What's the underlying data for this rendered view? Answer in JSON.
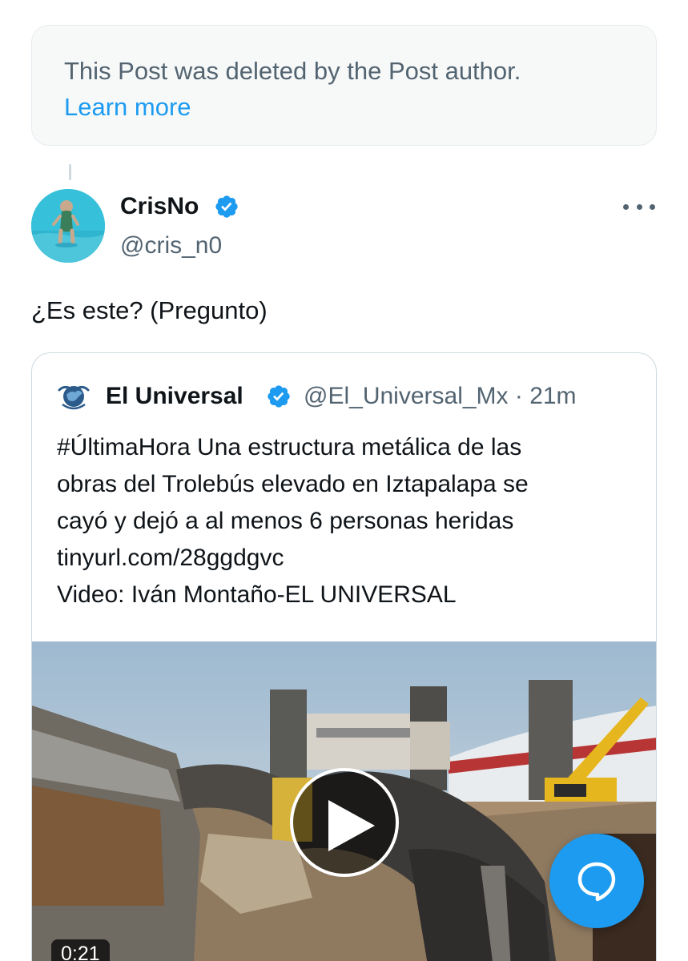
{
  "deleted_notice": {
    "text": "This Post was deleted by the Post author.",
    "link_label": "Learn more"
  },
  "post": {
    "author_name": "CrisNo",
    "author_handle": "@cris_n0",
    "verified": true,
    "more_icon": "more-horizontal-icon",
    "text": "¿Es este? (Pregunto)"
  },
  "quoted_post": {
    "author_name": "El Universal",
    "verified": true,
    "meta": "@El_Universal_Mx · 21m",
    "body_lines": [
      "#ÚltimaHora Una estructura metálica de las",
      "obras del Trolebús elevado en Iztapalapa se",
      "cayó y dejó a al menos 6 personas heridas",
      "tinyurl.com/28ggdgvc",
      "Video: Iván Montaño-EL UNIVERSAL"
    ],
    "video": {
      "duration": "0:21",
      "play_icon": "play-icon"
    }
  },
  "fab": {
    "icon": "reply-bubble-icon"
  },
  "colors": {
    "accent": "#1d9bf0",
    "secondary_text": "#536471",
    "primary_text": "#0f1419",
    "border": "#cfd9de",
    "notice_bg": "#f7f9f9"
  }
}
